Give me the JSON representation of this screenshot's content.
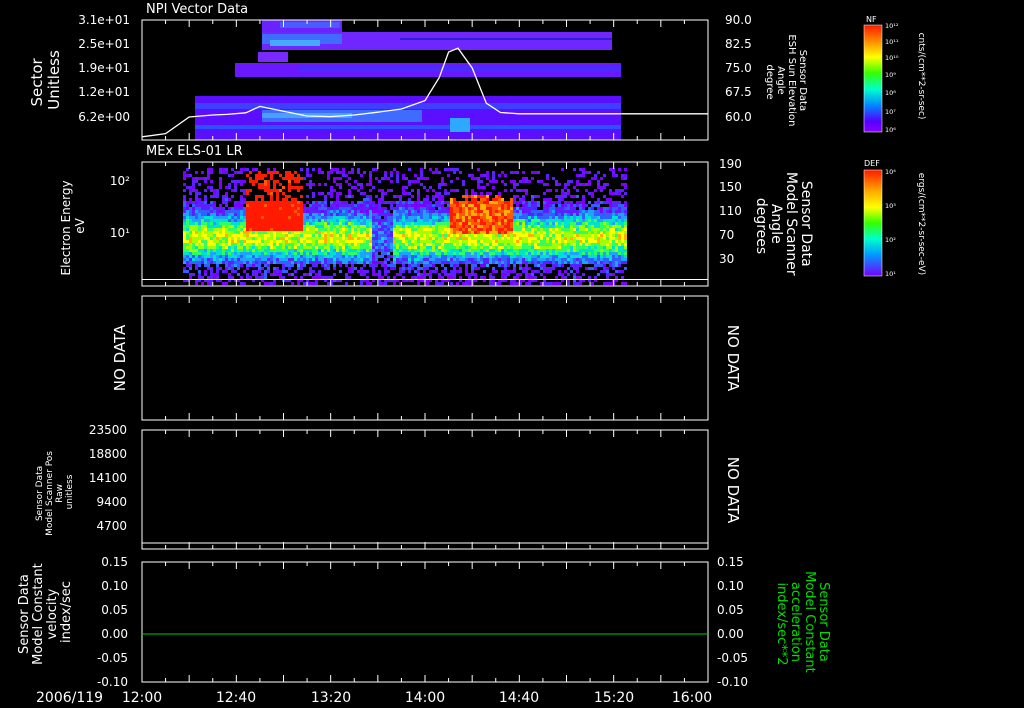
{
  "date_label": "2006/119",
  "time_axis": {
    "range": [
      "12:00",
      "16:00"
    ],
    "tick_labels": [
      "12:00",
      "12:40",
      "13:20",
      "14:00",
      "14:40",
      "15:20",
      "16:00"
    ]
  },
  "colors": {
    "background": "#000000",
    "axes": "#ffffff",
    "green_trace": "#00cc00",
    "green_label": "#00dd00",
    "spectrogram_low": "#6600ff",
    "spectrogram_high": "#ff2200"
  },
  "chart_data": [
    {
      "type": "heatmap",
      "title": "NPI Vector Data",
      "ylabel": "Sector\nUnitless",
      "y_tick_labels": [
        "3.1e+01",
        "2.5e+01",
        "1.9e+01",
        "1.2e+01",
        "6.2e+00"
      ],
      "right_ylabel": "Sensor Data\nESH Sun Elevation\nAngle\ndegree",
      "right_tick_labels": [
        "90.0",
        "82.5",
        "75.0",
        "67.5",
        "60.0"
      ],
      "right_ylim": [
        52.5,
        90
      ],
      "overlay_line": {
        "x": [
          "12:00",
          "12:10",
          "12:20",
          "12:30",
          "12:36",
          "12:44",
          "12:50",
          "13:00",
          "13:10",
          "13:20",
          "13:30",
          "13:40",
          "13:50",
          "14:00",
          "14:06",
          "14:10",
          "14:14",
          "14:20",
          "14:26",
          "14:32",
          "14:40",
          "15:00",
          "15:20",
          "15:40",
          "16:00"
        ],
        "y": [
          53.5,
          54.5,
          59.7,
          60.3,
          60.5,
          61.0,
          63.0,
          61.5,
          60.0,
          59.8,
          60.3,
          61.2,
          62.2,
          64.8,
          72.0,
          80.0,
          81.2,
          75.0,
          64.0,
          61.1,
          60.7,
          60.7,
          60.7,
          60.7,
          60.7
        ]
      },
      "colorbar": {
        "label": "NF",
        "units": "cnts/(cm**2-sr-sec)",
        "tick_labels": [
          "10¹²",
          "10¹¹",
          "10¹⁰",
          "10⁹",
          "10⁸",
          "10⁷",
          "10⁶"
        ]
      }
    },
    {
      "type": "heatmap",
      "title": "MEx ELS-01 LR",
      "ylabel": "Electron Energy\neV",
      "y_tick_labels": [
        "10²",
        "10¹"
      ],
      "right_ylabel": "Sensor Data\nModel Scanner\nAngle\ndegrees",
      "right_tick_labels": [
        "190",
        "150",
        "110",
        "70",
        "30"
      ],
      "right_ylim": [
        0,
        190
      ],
      "overlay_line": {
        "x": [
          "12:00",
          "16:00"
        ],
        "y": [
          10,
          10
        ]
      },
      "colorbar": {
        "label": "DEF",
        "units": "ergs/(cm**2-sr-sec-eV)",
        "tick_labels": [
          "10⁴",
          "10³",
          "10²",
          "10¹"
        ]
      }
    },
    {
      "type": "line",
      "title": "",
      "ylabel": "NO DATA",
      "right_label": "NO DATA"
    },
    {
      "type": "line",
      "ylabel": "Sensor Data\nModel Scanner Pos\nRaw\nunitless",
      "y_tick_labels": [
        "23500",
        "18800",
        "14100",
        "9400",
        "4700"
      ],
      "ylim": [
        0,
        23500
      ],
      "series": [
        {
          "x": [
            "12:00",
            "16:00"
          ],
          "y": [
            0,
            0
          ]
        }
      ],
      "right_label": "NO DATA"
    },
    {
      "type": "line",
      "ylabel": "Sensor Data\nModel Constant\nvelocity\nindex/sec",
      "y_tick_labels": [
        "0.15",
        "0.10",
        "0.05",
        "0.00",
        "-0.05",
        "-0.10"
      ],
      "ylim": [
        -0.1,
        0.15
      ],
      "right_ylabel": "Sensor Data\nModel Constant\nacceleration\nindex/sec**2",
      "right_tick_labels": [
        "0.15",
        "0.10",
        "0.05",
        "0.00",
        "-0.05",
        "-0.10"
      ],
      "series": [
        {
          "x": [
            "12:00",
            "16:00"
          ],
          "y": [
            0,
            0
          ]
        }
      ]
    }
  ]
}
